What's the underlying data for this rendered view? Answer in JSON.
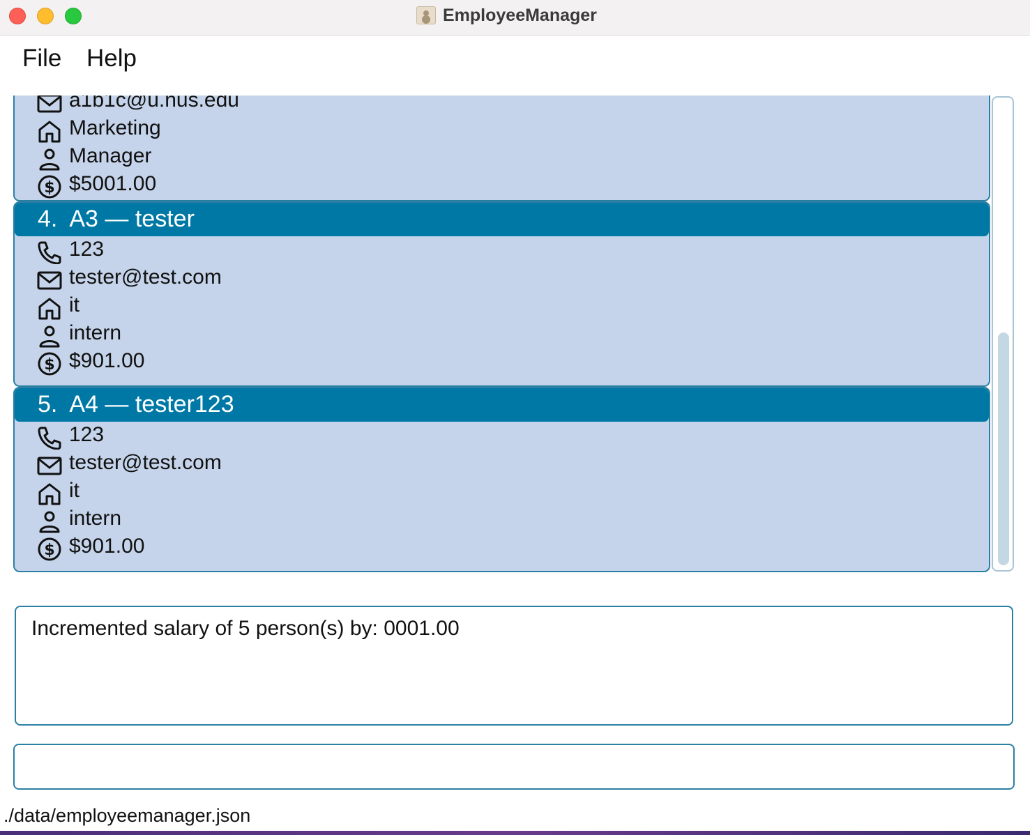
{
  "window": {
    "title": "EmployeeManager"
  },
  "menu": {
    "items": [
      {
        "label": "File"
      },
      {
        "label": "Help"
      }
    ]
  },
  "list": {
    "partial_card": {
      "email": "a1b1c@u.nus.edu",
      "department": "Marketing",
      "role": "Manager",
      "salary": "$5001.00"
    },
    "cards": [
      {
        "header": "4.  A3 — tester",
        "phone": "123",
        "email": "tester@test.com",
        "department": "it",
        "role": "intern",
        "salary": "$901.00"
      },
      {
        "header": "5.  A4 — tester123",
        "phone": "123",
        "email": "tester@test.com",
        "department": "it",
        "role": "intern",
        "salary": "$901.00"
      }
    ]
  },
  "result": {
    "text": "Incremented salary of 5 person(s) by: 0001.00"
  },
  "command": {
    "value": "",
    "placeholder": ""
  },
  "status": {
    "file_path": "./data/employeemanager.json"
  },
  "icons": {
    "phone": "phone-icon",
    "email": "mail-icon",
    "department": "home-icon",
    "role": "person-icon",
    "salary": "dollar-icon"
  },
  "colors": {
    "card_bg": "#c5d4ea",
    "card_header": "#0078a6",
    "border": "#2b7fa3"
  }
}
